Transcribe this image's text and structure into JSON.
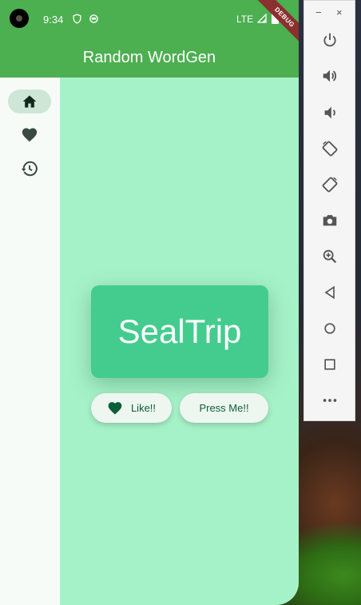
{
  "status_bar": {
    "time": "9:34",
    "network": "LTE"
  },
  "debug_banner": "DEBUG",
  "app_bar": {
    "title": "Random WordGen"
  },
  "nav_rail": {
    "items": [
      {
        "icon": "home-icon",
        "selected": true
      },
      {
        "icon": "heart-icon",
        "selected": false
      },
      {
        "icon": "history-icon",
        "selected": false
      }
    ]
  },
  "main": {
    "word": "SealTrip",
    "like_label": "Like!!",
    "press_label": "Press Me!!"
  },
  "emulator_panel": {
    "minimize": "−",
    "close": "×",
    "buttons": [
      "power-icon",
      "volume-up-icon",
      "volume-down-icon",
      "rotate-left-icon",
      "rotate-right-icon",
      "camera-icon",
      "zoom-icon",
      "back-icon",
      "home-circle-icon",
      "overview-square-icon",
      "more-icon"
    ]
  },
  "colors": {
    "app_bar": "#4caf50",
    "background": "#a6f2c8",
    "card": "#44cc8e",
    "accent_dark": "#0b5e38"
  }
}
